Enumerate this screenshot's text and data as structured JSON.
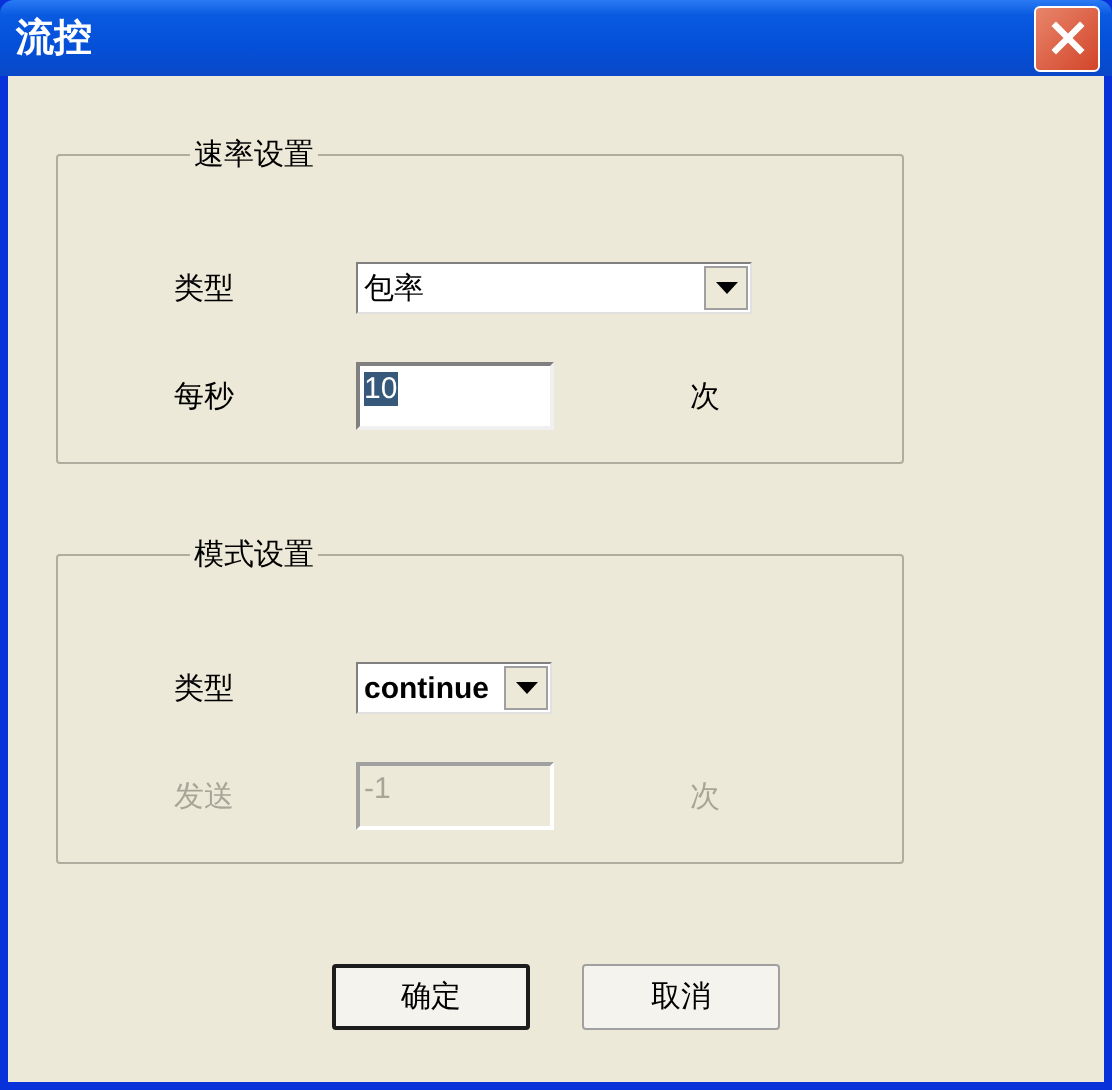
{
  "window": {
    "title": "流控"
  },
  "groups": [
    {
      "title": "速率设置",
      "rows": [
        {
          "kind": "combo",
          "label": "类型",
          "value": "包率",
          "disabled": false
        },
        {
          "kind": "field",
          "label": "每秒",
          "value": "10",
          "text_selected": true,
          "unit": "次",
          "disabled": false
        }
      ]
    },
    {
      "title": "模式设置",
      "rows": [
        {
          "kind": "combo",
          "label": "类型",
          "value": "continue",
          "disabled": false
        },
        {
          "kind": "field",
          "label": "发送",
          "value": "-1",
          "text_selected": false,
          "unit": "次",
          "disabled": true
        }
      ]
    }
  ],
  "buttons": [
    {
      "label": "确定",
      "default": true
    },
    {
      "label": "取消",
      "default": false
    }
  ]
}
